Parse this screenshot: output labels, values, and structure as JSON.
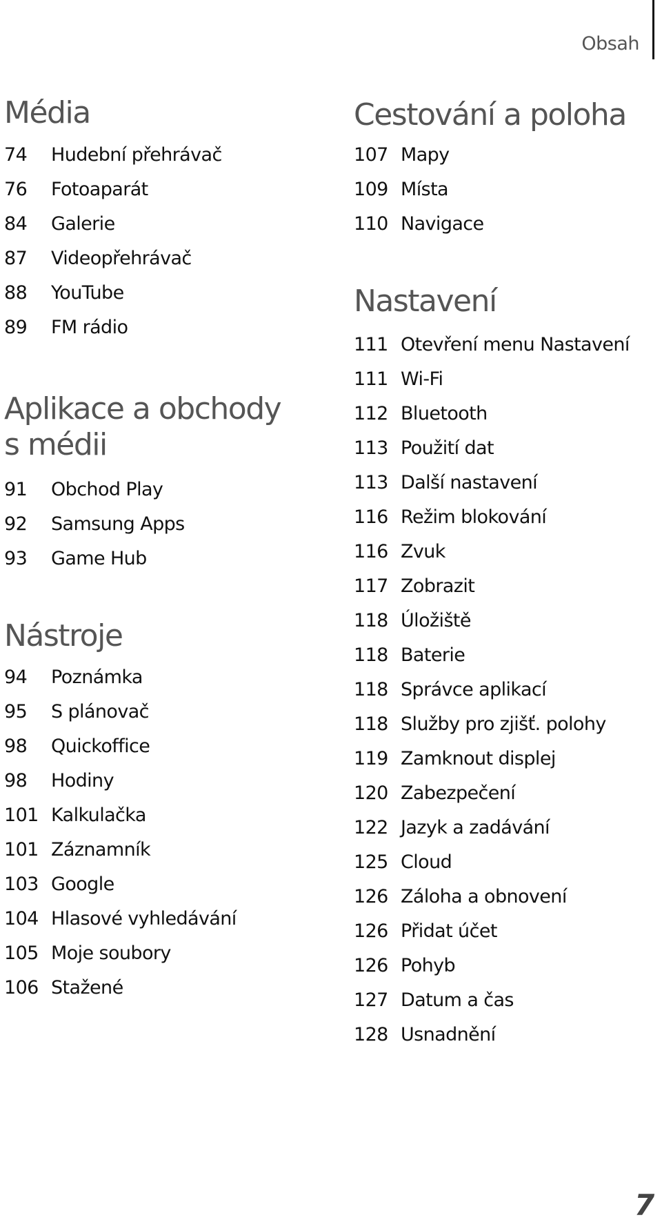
{
  "header": {
    "title": "Obsah"
  },
  "left_column": {
    "sections": [
      {
        "heading": [
          "Média"
        ],
        "items": [
          {
            "page": "74",
            "label": "Hudební přehrávač"
          },
          {
            "page": "76",
            "label": "Fotoaparát"
          },
          {
            "page": "84",
            "label": "Galerie"
          },
          {
            "page": "87",
            "label": "Videopřehrávač"
          },
          {
            "page": "88",
            "label": "YouTube"
          },
          {
            "page": "89",
            "label": "FM rádio"
          }
        ]
      },
      {
        "heading": [
          "Aplikace a obchody",
          "s médii"
        ],
        "items": [
          {
            "page": "91",
            "label": "Obchod Play"
          },
          {
            "page": "92",
            "label": "Samsung Apps"
          },
          {
            "page": "93",
            "label": "Game Hub"
          }
        ]
      },
      {
        "heading": [
          "Nástroje"
        ],
        "items": [
          {
            "page": "94",
            "label": "Poznámka"
          },
          {
            "page": "95",
            "label": "S plánovač"
          },
          {
            "page": "98",
            "label": "Quickoffice"
          },
          {
            "page": "98",
            "label": "Hodiny"
          },
          {
            "page": "101",
            "label": "Kalkulačka"
          },
          {
            "page": "101",
            "label": "Záznamník"
          },
          {
            "page": "103",
            "label": "Google"
          },
          {
            "page": "104",
            "label": "Hlasové vyhledávání"
          },
          {
            "page": "105",
            "label": "Moje soubory"
          },
          {
            "page": "106",
            "label": "Stažené"
          }
        ]
      }
    ]
  },
  "right_column": {
    "sections": [
      {
        "heading": [
          "Cestování a poloha"
        ],
        "items": [
          {
            "page": "107",
            "label": "Mapy"
          },
          {
            "page": "109",
            "label": "Místa"
          },
          {
            "page": "110",
            "label": "Navigace"
          }
        ]
      },
      {
        "heading": [
          "Nastavení"
        ],
        "items": [
          {
            "page": "111",
            "label": "Otevření menu Nastavení"
          },
          {
            "page": "111",
            "label": "Wi-Fi"
          },
          {
            "page": "112",
            "label": "Bluetooth"
          },
          {
            "page": "113",
            "label": "Použití dat"
          },
          {
            "page": "113",
            "label": "Další nastavení"
          },
          {
            "page": "116",
            "label": "Režim blokování"
          },
          {
            "page": "116",
            "label": "Zvuk"
          },
          {
            "page": "117",
            "label": "Zobrazit"
          },
          {
            "page": "118",
            "label": "Úložiště"
          },
          {
            "page": "118",
            "label": "Baterie"
          },
          {
            "page": "118",
            "label": "Správce aplikací"
          },
          {
            "page": "118",
            "label": "Služby pro zjišť. polohy"
          },
          {
            "page": "119",
            "label": "Zamknout displej"
          },
          {
            "page": "120",
            "label": "Zabezpečení"
          },
          {
            "page": "122",
            "label": "Jazyk a zadávání"
          },
          {
            "page": "125",
            "label": "Cloud"
          },
          {
            "page": "126",
            "label": "Záloha a obnovení"
          },
          {
            "page": "126",
            "label": "Přidat účet"
          },
          {
            "page": "126",
            "label": "Pohyb"
          },
          {
            "page": "127",
            "label": "Datum a čas"
          },
          {
            "page": "128",
            "label": "Usnadnění"
          }
        ]
      }
    ]
  },
  "footer": {
    "page_number": "7"
  }
}
